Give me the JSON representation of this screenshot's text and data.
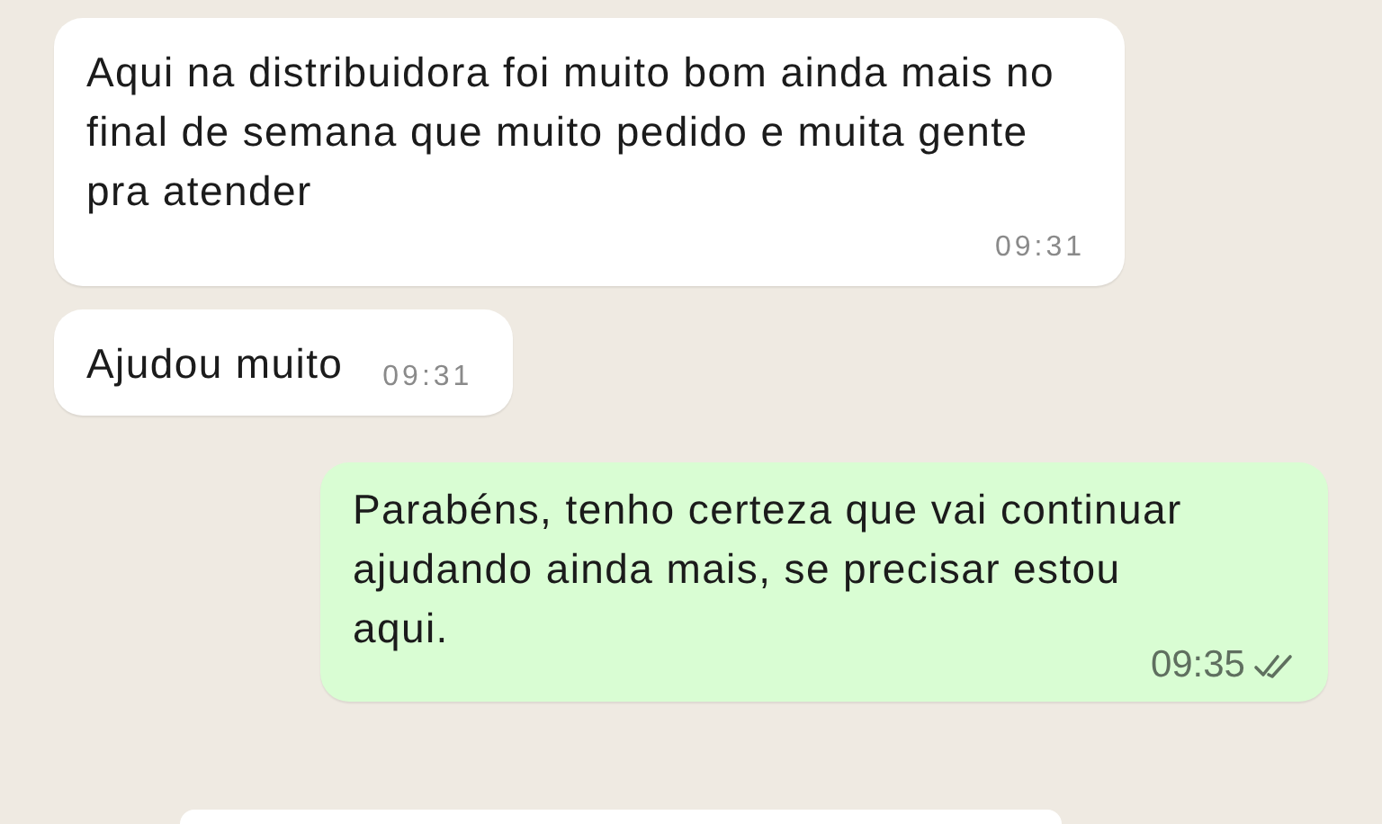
{
  "messages": [
    {
      "outgoing": false,
      "text": "Aqui na distribuidora foi muito bom ainda mais no final de semana que muito pedido e muita gente pra atender",
      "time": "09:31"
    },
    {
      "outgoing": false,
      "text": "Ajudou muito",
      "time": "09:31"
    },
    {
      "outgoing": true,
      "text": "Parabéns, tenho certeza que vai continuar ajudando ainda mais, se precisar estou aqui.",
      "time": "09:35",
      "read": false
    }
  ]
}
